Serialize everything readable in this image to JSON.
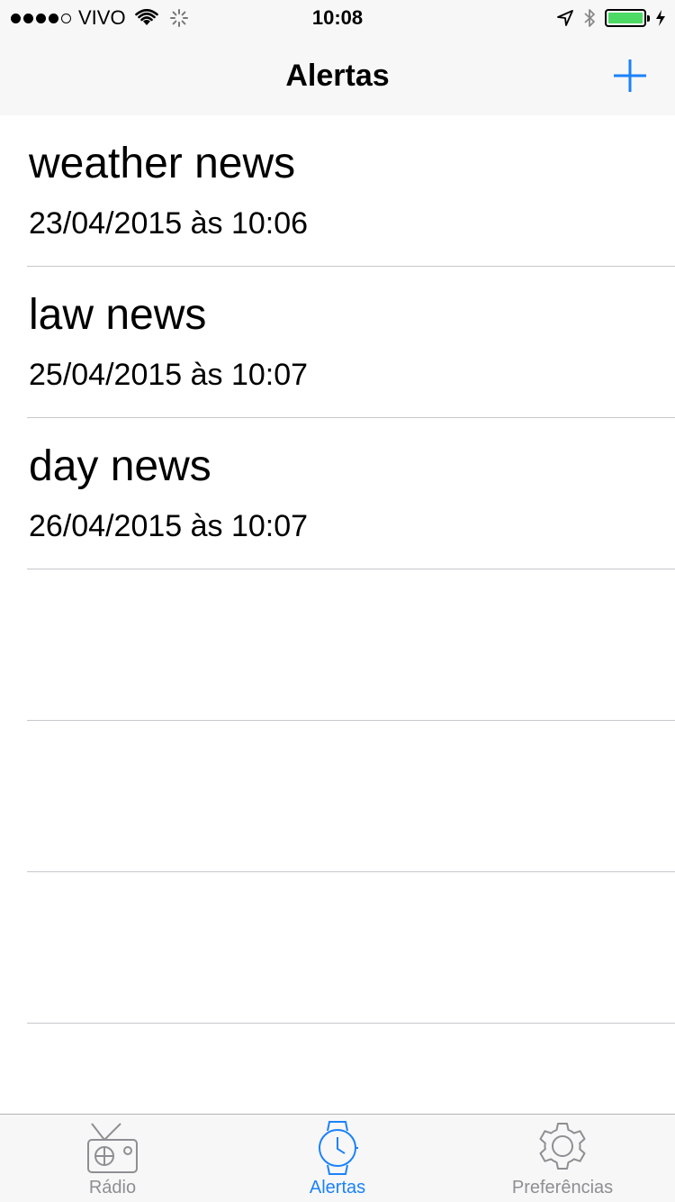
{
  "status_bar": {
    "carrier": "VIVO",
    "time": "10:08",
    "signal_bars": 4,
    "signal_total": 5,
    "battery_level": 1.0,
    "battery_color": "#4cd964"
  },
  "nav": {
    "title": "Alertas",
    "add_icon": "plus-icon",
    "accent": "#1a82fb"
  },
  "alerts": [
    {
      "title": "weather news",
      "date": "23/04/2015 às 10:06"
    },
    {
      "title": "law news",
      "date": "25/04/2015 às 10:07"
    },
    {
      "title": "day news",
      "date": "26/04/2015 às 10:07"
    },
    {
      "title": "",
      "date": ""
    },
    {
      "title": "",
      "date": ""
    },
    {
      "title": "",
      "date": ""
    }
  ],
  "tabs": [
    {
      "label": "Rádio",
      "icon": "radio-icon",
      "active": false
    },
    {
      "label": "Alertas",
      "icon": "watch-icon",
      "active": true
    },
    {
      "label": "Preferências",
      "icon": "gear-icon",
      "active": false
    }
  ]
}
